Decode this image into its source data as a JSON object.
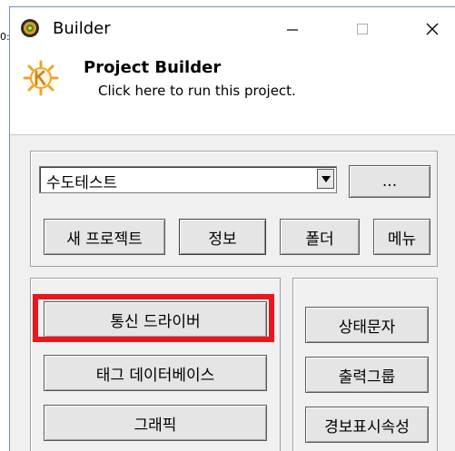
{
  "edge_fragment": "0:",
  "window": {
    "title": "Builder",
    "controls": {
      "minimize": "—",
      "maximize": "☐",
      "close": "✕"
    }
  },
  "header": {
    "title": "Project Builder",
    "subtitle": "Click here to run this project."
  },
  "project_select": {
    "value": "수도테스트",
    "arrow": "▼"
  },
  "browse_button": {
    "label": "..."
  },
  "top_buttons": {
    "new_project": "새 프로젝트",
    "info": "정보",
    "folder": "폴더",
    "menu": "메뉴"
  },
  "left_buttons": {
    "comm_driver": "통신 드라이버",
    "tag_db": "태그 데이터베이스",
    "graphic": "그래픽"
  },
  "right_buttons": {
    "status_text": "상태문자",
    "output_group": "출력그룹",
    "alarm_attr": "경보표시속성"
  },
  "colors": {
    "highlight": "#e8171e",
    "title_bg": "#ffffff",
    "panel_bg": "#f0f0f0"
  }
}
